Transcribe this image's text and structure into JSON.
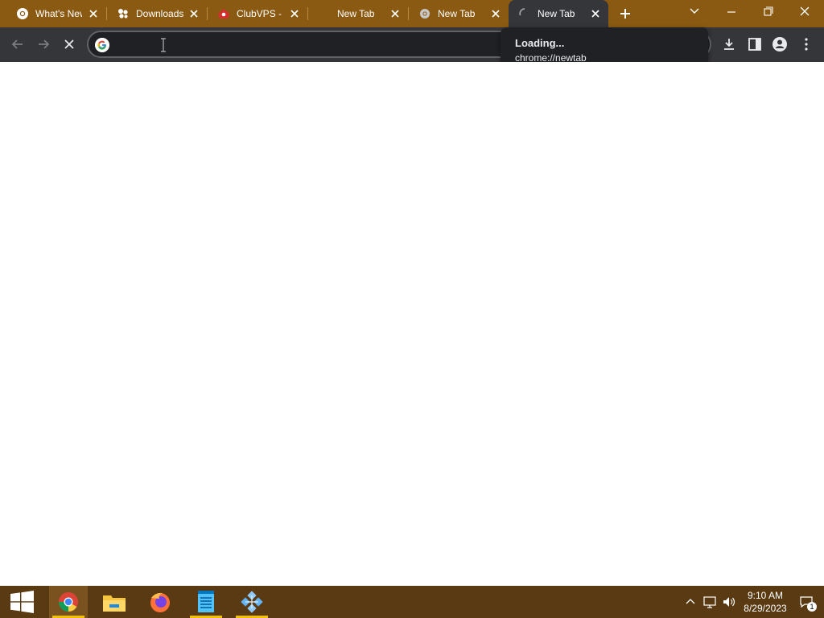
{
  "browser": {
    "tabs": [
      {
        "title": "What's New",
        "icon": "chrome-icon",
        "active": false
      },
      {
        "title": "Downloads",
        "icon": "downloads-puzzle-icon",
        "active": false
      },
      {
        "title": "ClubVPS - I",
        "icon": "clubvps-icon",
        "active": false
      },
      {
        "title": "New Tab",
        "icon": "blank-icon",
        "active": false
      },
      {
        "title": "New Tab",
        "icon": "chrome-icon",
        "active": false
      },
      {
        "title": "New Tab",
        "icon": "loading-spinner-icon",
        "active": true
      }
    ],
    "omnibox": {
      "value": "",
      "placeholder": ""
    },
    "tooltip": {
      "line1": "Loading...",
      "line2": "chrome://newtab"
    }
  },
  "taskbar": {
    "apps": [
      "start-windows-icon",
      "chrome-icon",
      "file-explorer-icon",
      "firefox-icon",
      "notepad-icon",
      "network-app-icon"
    ],
    "clock": {
      "time": "9:10 AM",
      "date": "8/29/2023"
    },
    "notification_count": "1"
  },
  "colors": {
    "tabstrip": "#8a5a12",
    "toolbar": "#35363a",
    "taskbar": "#5a3a12",
    "taskbar_indicator": "#f1c100"
  }
}
